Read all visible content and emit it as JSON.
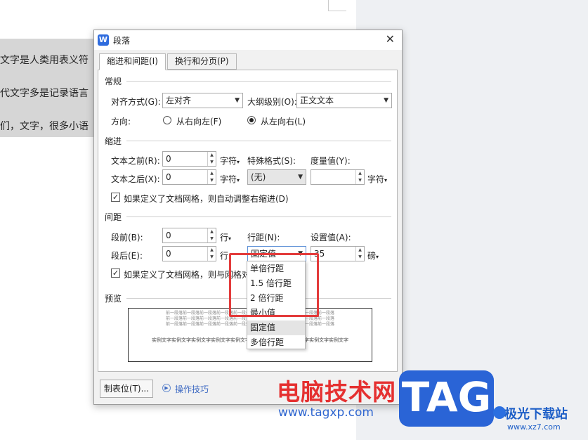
{
  "doc": {
    "lines": [
      "文字是人类用表义符",
      "代文字多是记录语言",
      "们，文字，很多小语"
    ]
  },
  "dialog": {
    "title": "段落",
    "tabs": [
      "缩进和间距(I)",
      "换行和分页(P)"
    ],
    "general": {
      "heading": "常规",
      "align_label": "对齐方式(G):",
      "align_value": "左对齐",
      "outline_label": "大纲级别(O):",
      "outline_value": "正文文本",
      "direction_label": "方向:",
      "rtl": "从右向左(F)",
      "ltr": "从左向右(L)"
    },
    "indent": {
      "heading": "缩进",
      "before_label": "文本之前(R):",
      "before_value": "0",
      "before_unit": "字符",
      "after_label": "文本之后(X):",
      "after_value": "0",
      "after_unit": "字符",
      "special_label": "特殊格式(S):",
      "special_value": "(无)",
      "measure_label": "度量值(Y):",
      "measure_value": "",
      "measure_unit": "字符",
      "grid_check": "如果定义了文档网格，则自动调整右缩进(D)"
    },
    "spacing": {
      "heading": "间距",
      "before_label": "段前(B):",
      "before_value": "0",
      "before_unit": "行",
      "after_label": "段后(E):",
      "after_value": "0",
      "after_unit": "行",
      "line_label": "行距(N):",
      "line_value": "固定值",
      "set_label": "设置值(A):",
      "set_value": "35",
      "set_unit": "磅",
      "grid_check": "如果定义了文档网格，则与网格对"
    },
    "preview": {
      "heading": "预览",
      "prev_line": "前一段落前一段落前一段落前一段落前一段落前一段落前一段落前一段落前一段落前一段落",
      "sample_line": "实例文字实例文字实例文字实例文字实例文字实例文字实例文字实例文字实例文字实例文字"
    },
    "tabs_button": "制表位(T)...",
    "tips": "操作技巧"
  },
  "dropdown": {
    "options": [
      "单倍行距",
      "1.5 倍行距",
      "2 倍行距",
      "最小值",
      "固定值",
      "多倍行距"
    ],
    "selected": "固定值"
  },
  "watermark": {
    "site_name": "电脑技术网",
    "site_url": "www.tagxp.com",
    "logo": "TAG",
    "brand": "极光下载站",
    "brand_url": "www.xz7.com"
  },
  "colors": {
    "accent": "#2a64d6",
    "highlight_box": "#e33b3b"
  }
}
